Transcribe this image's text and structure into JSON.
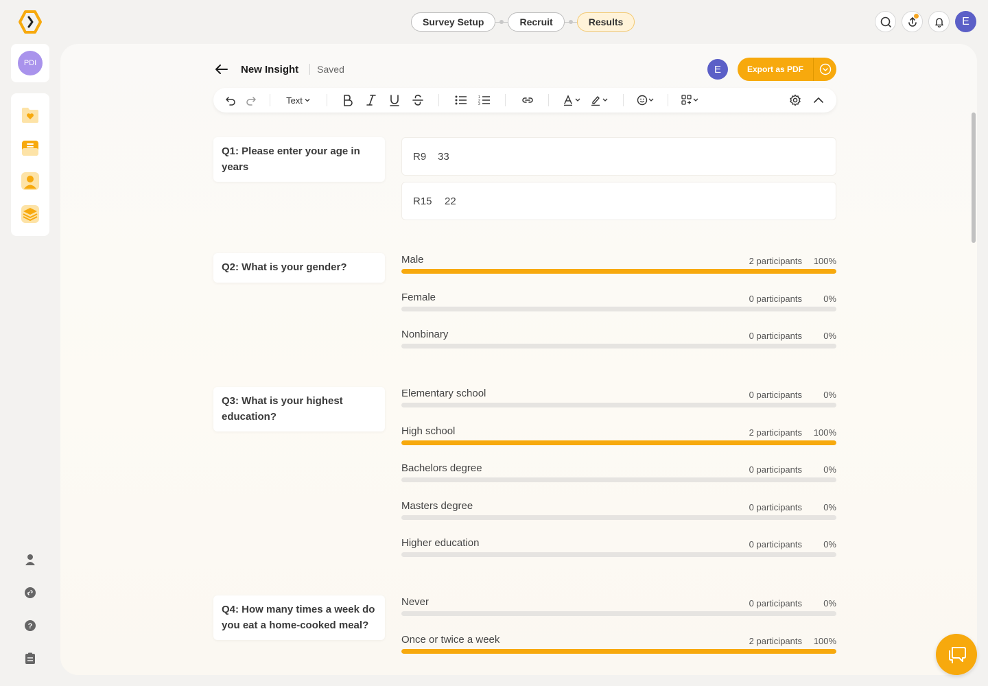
{
  "topbar": {
    "steps": [
      {
        "label": "Survey Setup",
        "active": false
      },
      {
        "label": "Recruit",
        "active": false
      },
      {
        "label": "Results",
        "active": true
      }
    ],
    "user_initial": "E"
  },
  "sidebar": {
    "org_initials": "PDI",
    "nav_icons": [
      "folder-heart-icon",
      "inbox-tray-icon",
      "participant-icon",
      "layers-icon"
    ],
    "bottom_icons": [
      "profile-icon",
      "integration-link-icon",
      "help-icon",
      "clipboard-icon"
    ]
  },
  "header": {
    "title": "New Insight",
    "status": "Saved",
    "author_initial": "E",
    "export_label": "Export as PDF"
  },
  "toolbar": {
    "text_style": "Text"
  },
  "questions": [
    {
      "title": "Q1: Please enter your age in years",
      "responses": [
        {
          "id": "R9",
          "value": "33"
        },
        {
          "id": "R15",
          "value": "22"
        }
      ]
    },
    {
      "title": "Q2: What is your gender?",
      "options": [
        {
          "label": "Male",
          "count": "2 participants",
          "pct": "100%",
          "fraction": 1.0
        },
        {
          "label": "Female",
          "count": "0 participants",
          "pct": "0%",
          "fraction": 0
        },
        {
          "label": "Nonbinary",
          "count": "0 participants",
          "pct": "0%",
          "fraction": 0
        }
      ]
    },
    {
      "title": "Q3: What is your highest education?",
      "options": [
        {
          "label": "Elementary school",
          "count": "0 participants",
          "pct": "0%",
          "fraction": 0
        },
        {
          "label": "High school",
          "count": "2 participants",
          "pct": "100%",
          "fraction": 1.0
        },
        {
          "label": "Bachelors degree",
          "count": "0 participants",
          "pct": "0%",
          "fraction": 0
        },
        {
          "label": "Masters degree",
          "count": "0 participants",
          "pct": "0%",
          "fraction": 0
        },
        {
          "label": "Higher education",
          "count": "0 participants",
          "pct": "0%",
          "fraction": 0
        }
      ]
    },
    {
      "title": "Q4: How many times a week do you eat a home-cooked meal?",
      "options": [
        {
          "label": "Never",
          "count": "0 participants",
          "pct": "0%",
          "fraction": 0
        },
        {
          "label": "Once or twice a week",
          "count": "2 participants",
          "pct": "100%",
          "fraction": 1.0
        }
      ]
    }
  ],
  "colors": {
    "accent": "#f7a90d",
    "bar_track": "#e6e4e1",
    "avatar": "#5b5fc7",
    "org_avatar": "#a993ec"
  }
}
